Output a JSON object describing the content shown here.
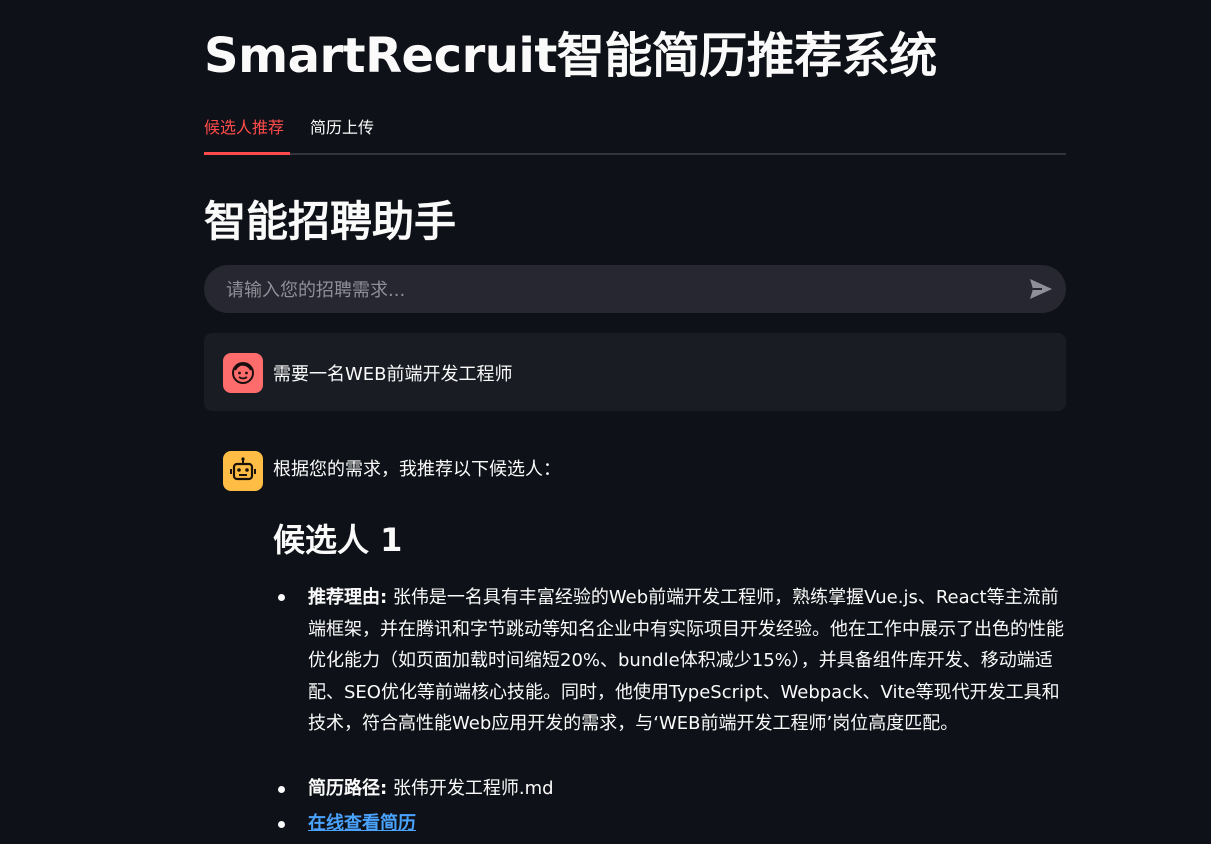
{
  "app_title": "SmartRecruit智能简历推荐系统",
  "tabs": [
    {
      "label": "候选人推荐",
      "active": true
    },
    {
      "label": "简历上传",
      "active": false
    }
  ],
  "section_title": "智能招聘助手",
  "chat_input": {
    "placeholder": "请输入您的招聘需求...",
    "value": "",
    "send_icon": "send-icon"
  },
  "messages": {
    "user": {
      "avatar_icon": "user-face-icon",
      "text": "需要一名WEB前端开发工程师"
    },
    "assistant": {
      "avatar_icon": "robot-icon",
      "intro": "根据您的需求，我推荐以下候选人："
    }
  },
  "candidate": {
    "title": "候选人 1",
    "reason_label": "推荐理由:",
    "reason_text": " 张伟是一名具有丰富经验的Web前端开发工程师，熟练掌握Vue.js、React等主流前端框架，并在腾讯和字节跳动等知名企业中有实际项目开发经验。他在工作中展示了出色的性能优化能力（如页面加载时间缩短20%、bundle体积减少15%），并具备组件库开发、移动端适配、SEO优化等前端核心技能。同时，他使用TypeScript、Webpack、Vite等现代开发工具和技术，符合高性能Web应用开发的需求，与‘WEB前端开发工程师’岗位高度匹配。",
    "path_label": "简历路径:",
    "path_value": " 张伟开发工程师.md",
    "link_text": "在线查看简历"
  },
  "colors": {
    "background": "#0e1117",
    "accent": "#ff4b4b",
    "input_bg": "#262730",
    "user_msg_bg": "#1a1c24",
    "user_avatar": "#ff6c6c",
    "bot_avatar": "#ffbd45",
    "link": "#4aa3ff"
  }
}
